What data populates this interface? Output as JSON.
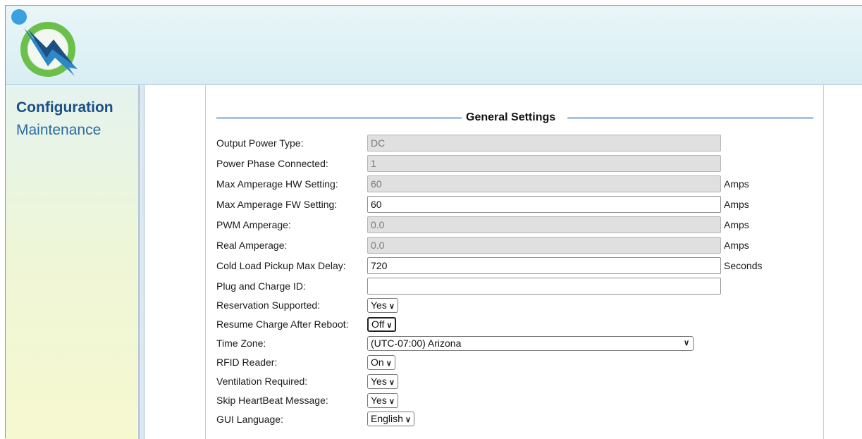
{
  "nav": {
    "items": [
      {
        "label": "Configuration",
        "active": true
      },
      {
        "label": "Maintenance",
        "active": false
      }
    ]
  },
  "settings": {
    "title": "General Settings",
    "fields": [
      {
        "label": "Output Power Type:",
        "value": "DC",
        "readonly": true
      },
      {
        "label": "Power Phase Connected:",
        "value": "1",
        "readonly": true
      },
      {
        "label": "Max Amperage HW Setting:",
        "value": "60",
        "readonly": true,
        "unit": "Amps"
      },
      {
        "label": "Max Amperage FW Setting:",
        "value": "60",
        "readonly": false,
        "unit": "Amps"
      },
      {
        "label": "PWM Amperage:",
        "value": "0.0",
        "readonly": true,
        "unit": "Amps"
      },
      {
        "label": "Real Amperage:",
        "value": "0.0",
        "readonly": true,
        "unit": "Amps"
      },
      {
        "label": "Cold Load Pickup Max Delay:",
        "value": "720",
        "readonly": false,
        "unit": "Seconds"
      },
      {
        "label": "Plug and Charge ID:",
        "value": "",
        "readonly": false
      }
    ],
    "selects": [
      {
        "label": "Reservation Supported:",
        "value": "Yes"
      },
      {
        "label": "Resume Charge After Reboot:",
        "value": "Off"
      },
      {
        "label": "Time Zone:",
        "value": "(UTC-07:00) Arizona"
      },
      {
        "label": "RFID Reader:",
        "value": "On"
      },
      {
        "label": "Ventilation Required:",
        "value": "Yes"
      },
      {
        "label": "Skip HeartBeat Message:",
        "value": "Yes"
      },
      {
        "label": "GUI Language:",
        "value": "English"
      }
    ]
  },
  "colors": {
    "accent": "#1b4f86",
    "header_bg": "#e3f3f6",
    "legend_line": "#a9c3e6",
    "readonly_bg": "#e0e0e0"
  },
  "icons": {
    "logo": "charging-logo-icon",
    "select_arrow": "chevron-down-icon"
  }
}
